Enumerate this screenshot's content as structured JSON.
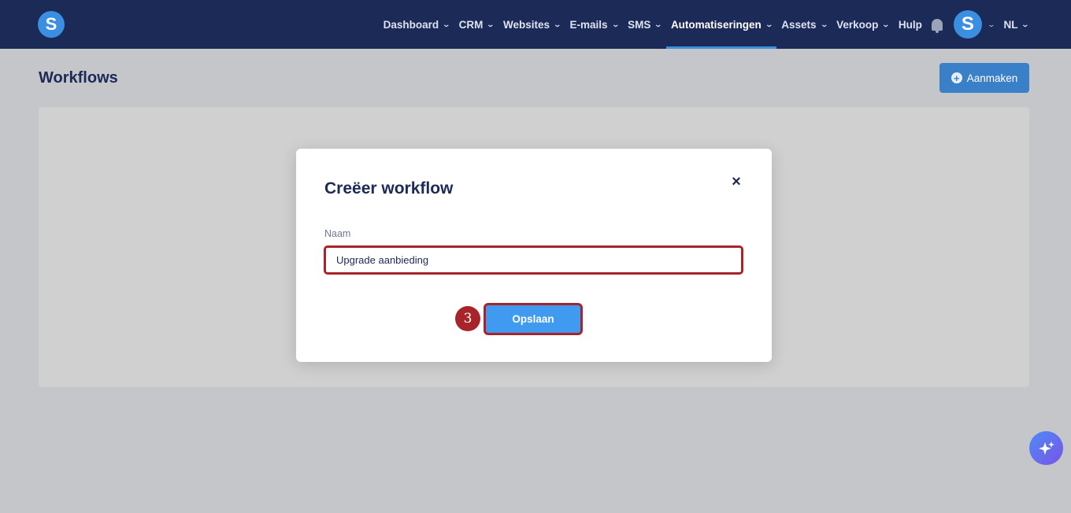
{
  "app": {
    "logo_letter": "S"
  },
  "nav": {
    "items": [
      {
        "label": "Dashboard",
        "has_chevron": true
      },
      {
        "label": "CRM",
        "has_chevron": true
      },
      {
        "label": "Websites",
        "has_chevron": true
      },
      {
        "label": "E-mails",
        "has_chevron": true
      },
      {
        "label": "SMS",
        "has_chevron": true
      },
      {
        "label": "Automatiseringen",
        "has_chevron": true,
        "active": true
      },
      {
        "label": "Assets",
        "has_chevron": true
      },
      {
        "label": "Verkoop",
        "has_chevron": true
      },
      {
        "label": "Hulp",
        "has_chevron": false
      }
    ],
    "avatar_letter": "S",
    "language": "NL"
  },
  "page": {
    "title": "Workflows",
    "create_button": "Aanmaken"
  },
  "modal": {
    "title": "Creëer workflow",
    "close_symbol": "×",
    "name_label": "Naam",
    "name_value": "Upgrade aanbieding",
    "save_button": "Opslaan",
    "step_number": "3"
  },
  "colors": {
    "topbar": "#1b2a56",
    "accent": "#3f9af0",
    "highlight": "#a7242b"
  },
  "icons": {
    "bell": "bell-icon",
    "plus": "plus-circle-icon",
    "close": "close-icon",
    "ai": "sparkle-icon"
  }
}
